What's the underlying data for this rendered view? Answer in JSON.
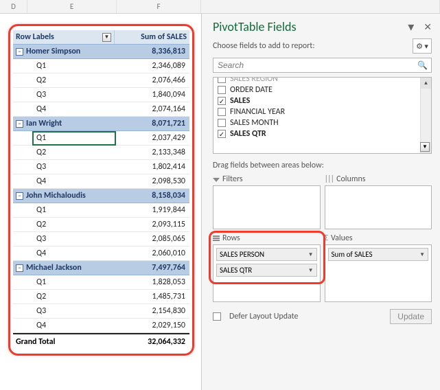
{
  "columns": [
    "D",
    "E",
    "F",
    "",
    "",
    "",
    "",
    "",
    ""
  ],
  "pivot": {
    "row_label_header": "Row Labels",
    "value_header": "Sum of SALES",
    "groups": [
      {
        "name": "Homer Simpson",
        "total": "8,336,813",
        "rows": [
          {
            "k": "Q1",
            "v": "2,346,089"
          },
          {
            "k": "Q2",
            "v": "2,076,466"
          },
          {
            "k": "Q3",
            "v": "1,840,094"
          },
          {
            "k": "Q4",
            "v": "2,074,164"
          }
        ]
      },
      {
        "name": "Ian Wright",
        "total": "8,071,721",
        "rows": [
          {
            "k": "Q1",
            "v": "2,037,429",
            "selected": true
          },
          {
            "k": "Q2",
            "v": "2,133,348"
          },
          {
            "k": "Q3",
            "v": "1,802,414"
          },
          {
            "k": "Q4",
            "v": "2,098,530"
          }
        ]
      },
      {
        "name": "John Michaloudis",
        "total": "8,158,034",
        "rows": [
          {
            "k": "Q1",
            "v": "1,919,844"
          },
          {
            "k": "Q2",
            "v": "2,093,115"
          },
          {
            "k": "Q3",
            "v": "2,085,065"
          },
          {
            "k": "Q4",
            "v": "2,060,010"
          }
        ]
      },
      {
        "name": "Michael Jackson",
        "total": "7,497,764",
        "rows": [
          {
            "k": "Q1",
            "v": "1,828,053"
          },
          {
            "k": "Q2",
            "v": "1,485,731"
          },
          {
            "k": "Q3",
            "v": "2,154,830"
          },
          {
            "k": "Q4",
            "v": "2,029,150"
          }
        ]
      }
    ],
    "grand_label": "Grand Total",
    "grand_value": "32,064,332"
  },
  "pane": {
    "title": "PivotTable Fields",
    "choose_label": "Choose fields to add to report:",
    "search_placeholder": "Search",
    "fields": [
      {
        "label": "SALES REGION",
        "checked": false,
        "partial": true
      },
      {
        "label": "ORDER DATE",
        "checked": false
      },
      {
        "label": "SALES",
        "checked": true,
        "bold": true
      },
      {
        "label": "FINANCIAL YEAR",
        "checked": false
      },
      {
        "label": "SALES MONTH",
        "checked": false
      },
      {
        "label": "SALES QTR",
        "checked": true,
        "bold": true
      }
    ],
    "drag_label": "Drag fields between areas below:",
    "areas": {
      "filters_label": "Filters",
      "columns_label": "Columns",
      "rows_label": "Rows",
      "values_label": "Values",
      "rows": [
        "SALES PERSON",
        "SALES QTR"
      ],
      "values": [
        "Sum of SALES"
      ]
    },
    "defer_label": "Defer Layout Update",
    "update_label": "Update"
  }
}
